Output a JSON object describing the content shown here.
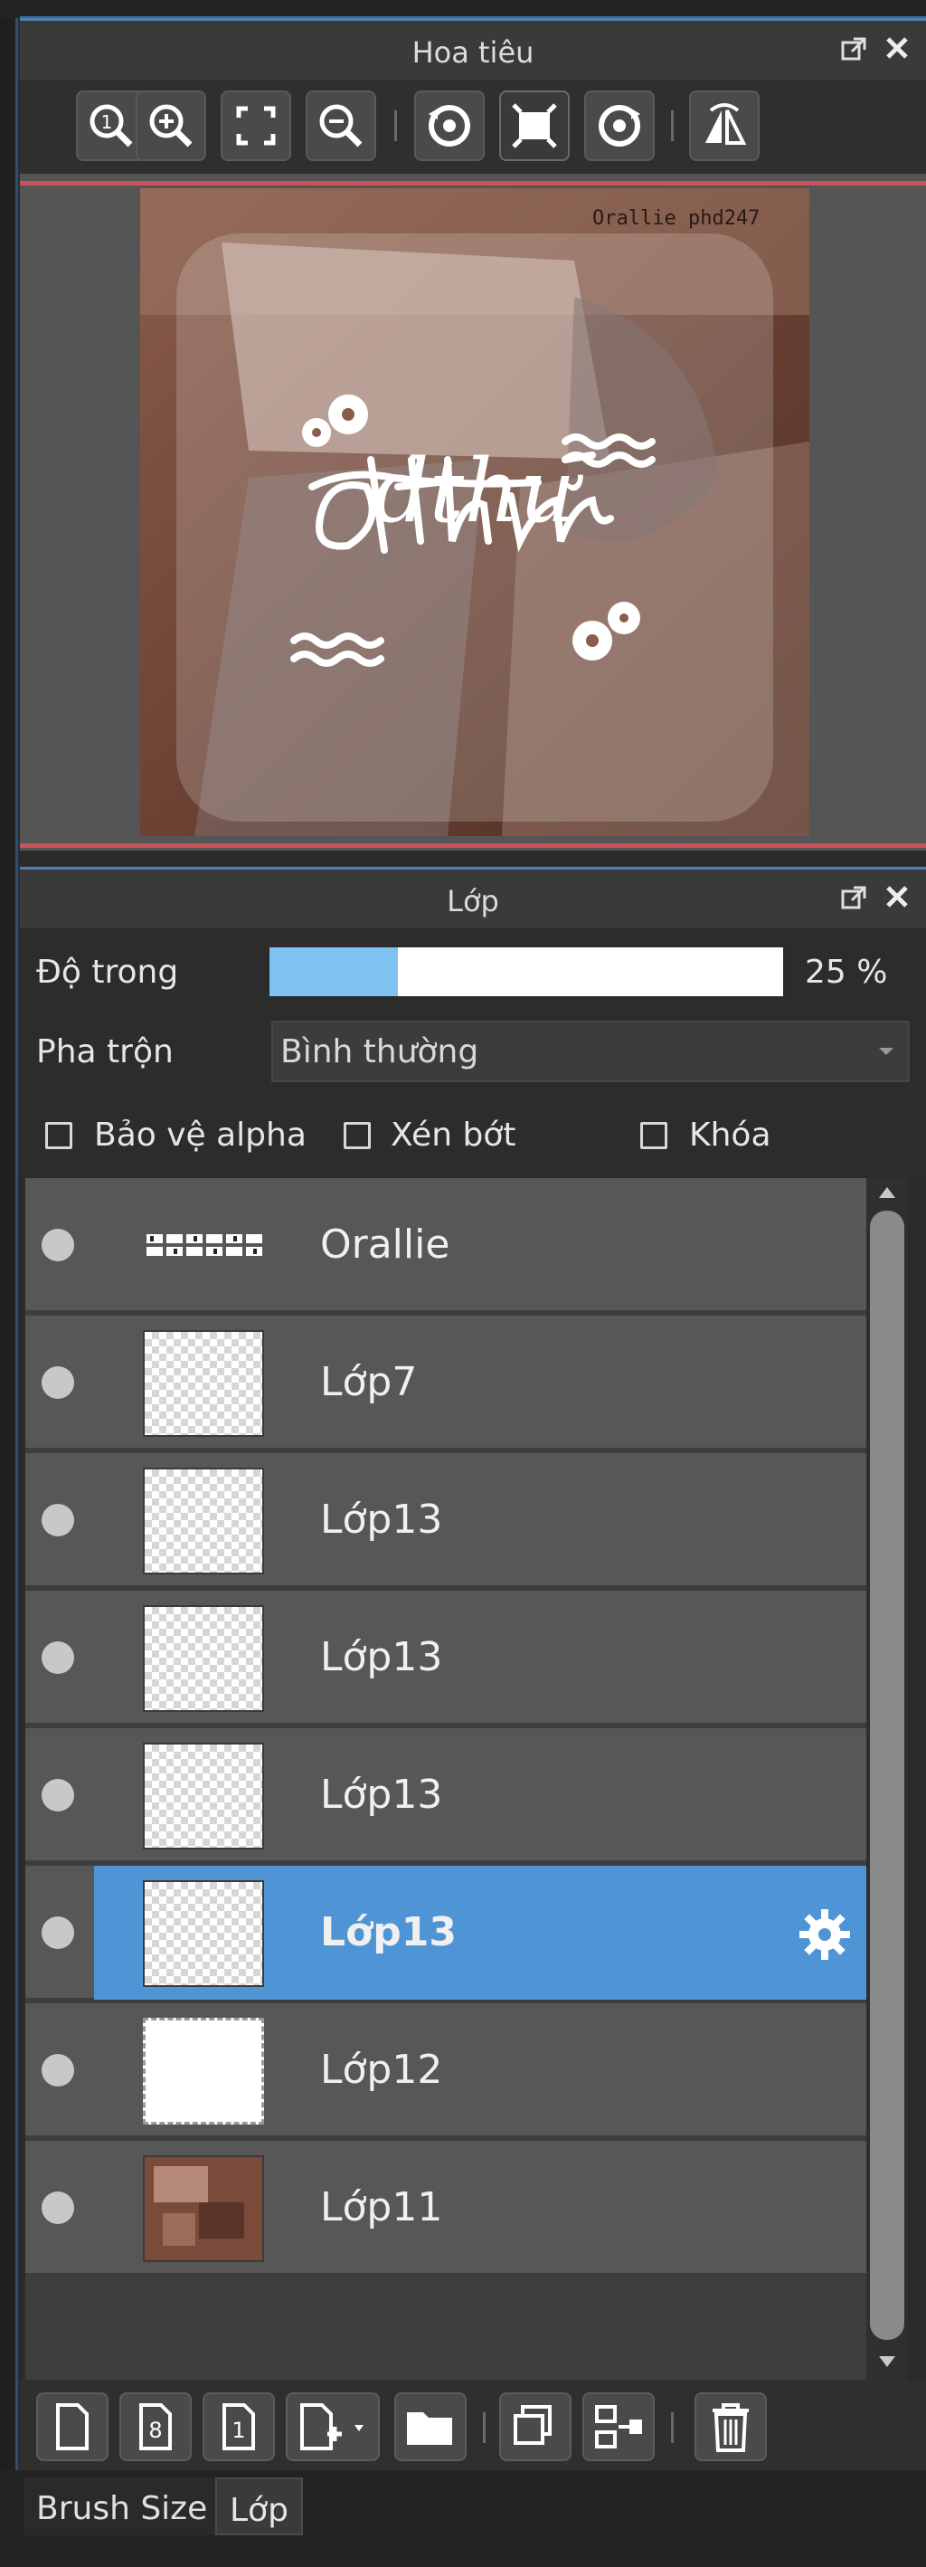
{
  "navigator": {
    "title": "Hoa tiêu",
    "toolbar_icons": [
      "zoom-100-icon",
      "zoom-in-icon",
      "fit-screen-icon",
      "zoom-out-icon",
      "rotate-left-icon",
      "fit-canvas-icon",
      "rotate-right-icon",
      "flip-horizontal-icon"
    ],
    "preview_text": "dthư",
    "watermark": "Orallie phd247"
  },
  "layers_panel": {
    "title": "Lớp",
    "opacity_label": "Độ trong",
    "opacity_value": "25 %",
    "opacity_fraction": 0.25,
    "blend_label": "Pha trộn",
    "blend_value": "Bình thường",
    "checkboxes": [
      {
        "label": "Bảo vệ alpha",
        "checked": false
      },
      {
        "label": "Xén bớt",
        "checked": false
      },
      {
        "label": "Khóa",
        "checked": false
      }
    ],
    "layers": [
      {
        "name": "Orallie",
        "selected": false
      },
      {
        "name": "Lớp7",
        "selected": false
      },
      {
        "name": "Lớp13",
        "selected": false
      },
      {
        "name": "Lớp13",
        "selected": false
      },
      {
        "name": "Lớp13",
        "selected": false
      },
      {
        "name": "Lớp13",
        "selected": true
      },
      {
        "name": "Lớp12",
        "selected": false
      },
      {
        "name": "Lớp11",
        "selected": false
      }
    ],
    "bottom_icons": [
      "new-layer-icon",
      "new-8bit-layer-icon",
      "new-1bit-layer-icon",
      "add-layer-menu-icon",
      "folder-icon",
      "duplicate-layer-icon",
      "merge-down-icon",
      "delete-icon"
    ]
  },
  "tabs": [
    {
      "label": "Brush Size",
      "active": false
    },
    {
      "label": "Lớp",
      "active": true
    }
  ],
  "colors": {
    "accent": "#4f94d4",
    "slider_fill": "#7ec2f2",
    "red_guide": "#c9545c"
  }
}
